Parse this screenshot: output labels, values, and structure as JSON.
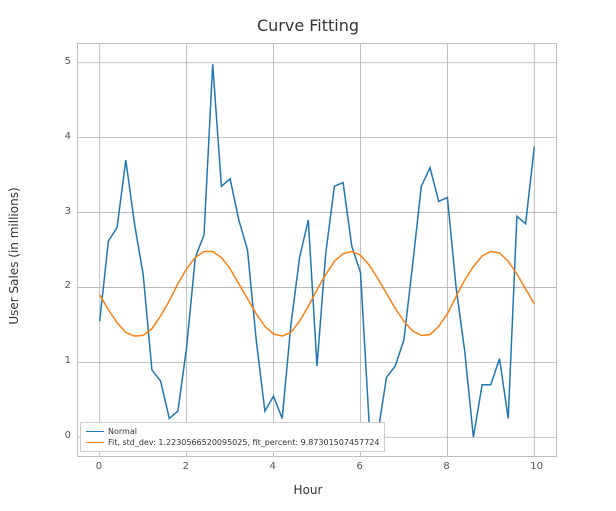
{
  "chart_data": {
    "type": "line",
    "title": "Curve Fitting",
    "xlabel": "Hour",
    "ylabel": "User Sales (in millions)",
    "xlim": [
      -0.5,
      10.5
    ],
    "ylim": [
      -0.25,
      5.25
    ],
    "xticks": [
      0,
      2,
      4,
      6,
      8,
      10
    ],
    "yticks": [
      0,
      1,
      2,
      3,
      4,
      5
    ],
    "x": [
      0.0,
      0.2,
      0.4,
      0.6,
      0.8,
      1.0,
      1.2,
      1.4,
      1.6,
      1.8,
      2.0,
      2.2,
      2.4,
      2.6,
      2.8,
      3.0,
      3.2,
      3.4,
      3.6,
      3.8,
      4.0,
      4.2,
      4.4,
      4.6,
      4.8,
      5.0,
      5.2,
      5.4,
      5.6,
      5.8,
      6.0,
      6.2,
      6.4,
      6.6,
      6.8,
      7.0,
      7.2,
      7.4,
      7.6,
      7.8,
      8.0,
      8.2,
      8.4,
      8.6,
      8.8,
      9.0,
      9.2,
      9.4,
      9.6,
      9.8,
      10.0
    ],
    "series": [
      {
        "name": "Normal",
        "color": "#1f77b4",
        "values": [
          1.55,
          2.62,
          2.8,
          3.7,
          2.85,
          2.17,
          0.9,
          0.75,
          0.25,
          0.35,
          1.2,
          2.4,
          2.7,
          4.98,
          3.35,
          3.45,
          2.9,
          2.5,
          1.3,
          0.35,
          0.55,
          0.25,
          1.5,
          2.4,
          2.9,
          0.95,
          2.45,
          3.35,
          3.4,
          2.55,
          2.2,
          0.2,
          0.05,
          0.8,
          0.95,
          1.3,
          2.3,
          3.35,
          3.6,
          3.15,
          3.2,
          2.0,
          1.15,
          0.0,
          0.7,
          0.7,
          1.05,
          0.25,
          2.95,
          2.85,
          3.88
        ]
      },
      {
        "name": "Fit, std_dev: 1.2230566520095025, fit_percent: 9.87301507457724",
        "color": "#ff7f0e",
        "values": [
          1.9,
          1.7,
          1.53,
          1.4,
          1.35,
          1.36,
          1.45,
          1.62,
          1.82,
          2.05,
          2.25,
          2.4,
          2.48,
          2.48,
          2.4,
          2.25,
          2.05,
          1.85,
          1.65,
          1.48,
          1.38,
          1.35,
          1.4,
          1.55,
          1.75,
          1.97,
          2.17,
          2.35,
          2.45,
          2.48,
          2.43,
          2.3,
          2.12,
          1.92,
          1.72,
          1.55,
          1.42,
          1.36,
          1.37,
          1.48,
          1.65,
          1.88,
          2.1,
          2.28,
          2.42,
          2.48,
          2.46,
          2.35,
          2.18,
          1.98,
          1.78
        ]
      }
    ],
    "legend": {
      "position": "lower left",
      "entries": [
        "Normal",
        "Fit, std_dev: 1.2230566520095025, fit_percent: 9.87301507457724"
      ]
    },
    "grid": true
  }
}
